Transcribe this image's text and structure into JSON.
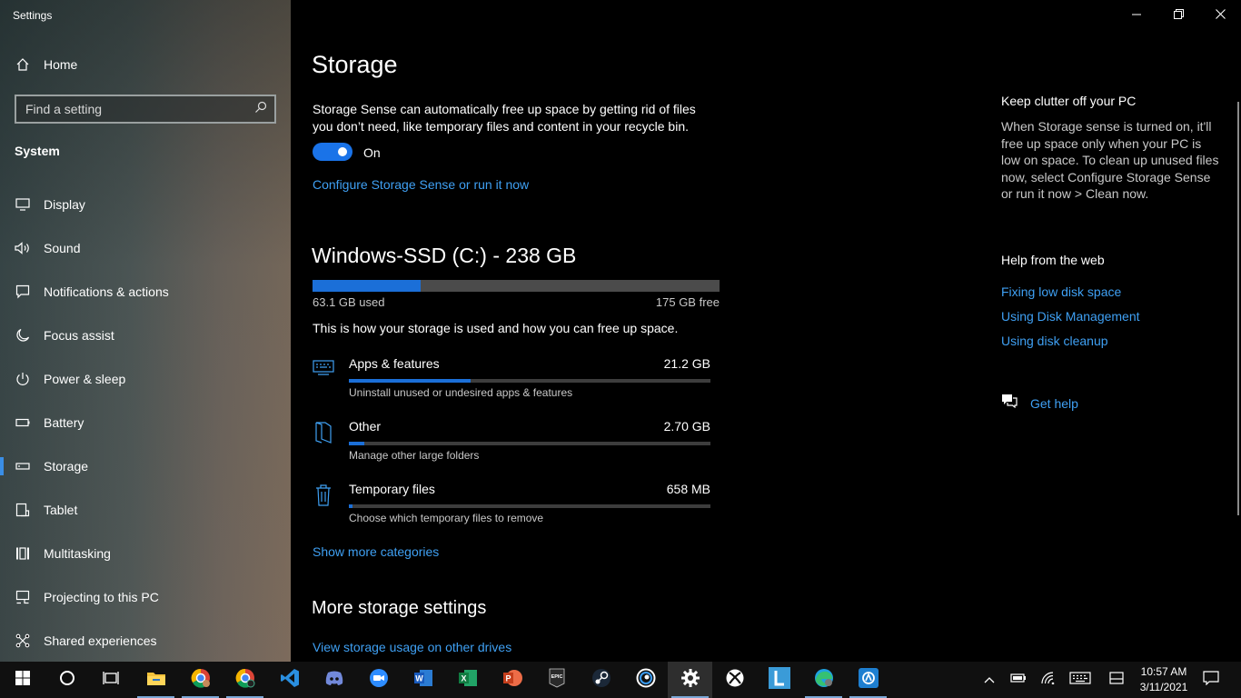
{
  "window": {
    "title": "Settings",
    "controls": {
      "minimize": "minimize",
      "restore": "restore",
      "close": "close"
    }
  },
  "sidebar": {
    "home_label": "Home",
    "search_placeholder": "Find a setting",
    "section_label": "System",
    "items": [
      {
        "label": "Display",
        "icon": "monitor-icon"
      },
      {
        "label": "Sound",
        "icon": "speaker-icon"
      },
      {
        "label": "Notifications & actions",
        "icon": "message-icon"
      },
      {
        "label": "Focus assist",
        "icon": "moon-icon"
      },
      {
        "label": "Power & sleep",
        "icon": "power-icon"
      },
      {
        "label": "Battery",
        "icon": "battery-icon"
      },
      {
        "label": "Storage",
        "icon": "drive-icon",
        "active": true
      },
      {
        "label": "Tablet",
        "icon": "tablet-icon"
      },
      {
        "label": "Multitasking",
        "icon": "multitasking-icon"
      },
      {
        "label": "Projecting to this PC",
        "icon": "projector-icon"
      },
      {
        "label": "Shared experiences",
        "icon": "share-icon"
      }
    ]
  },
  "main": {
    "title": "Storage",
    "storage_sense": {
      "description": "Storage Sense can automatically free up space by getting rid of files you don’t need, like temporary files and content in your recycle bin.",
      "toggle_state": "On",
      "configure_link": "Configure Storage Sense or run it now"
    },
    "drive": {
      "title": "Windows-SSD (C:) - 238 GB",
      "used_label": "63.1 GB used",
      "free_label": "175 GB free",
      "used_fraction": 0.265,
      "usage_description": "This is how your storage is used and how you can free up space."
    },
    "categories": [
      {
        "name": "Apps & features",
        "size": "21.2 GB",
        "description": "Uninstall unused or undesired apps & features",
        "fraction": 0.336,
        "icon": "keyboard-icon"
      },
      {
        "name": "Other",
        "size": "2.70 GB",
        "description": "Manage other large folders",
        "fraction": 0.043,
        "icon": "folder-icon"
      },
      {
        "name": "Temporary files",
        "size": "658 MB",
        "description": "Choose which temporary files to remove",
        "fraction": 0.01,
        "icon": "trash-icon"
      }
    ],
    "show_more_link": "Show more categories",
    "more_settings_title": "More storage settings",
    "other_drives_link": "View storage usage on other drives"
  },
  "side_panel": {
    "clutter_heading": "Keep clutter off your PC",
    "clutter_description": "When Storage sense is turned on, it'll free up space only when your PC is low on space. To clean up unused files now, select Configure Storage Sense or run it now > Clean now.",
    "help_heading": "Help from the web",
    "help_links": [
      "Fixing low disk space",
      "Using Disk Management",
      "Using disk cleanup"
    ],
    "get_help_label": "Get help"
  },
  "taskbar": {
    "apps": [
      "start",
      "cortana",
      "task-view",
      "file-explorer",
      "chrome",
      "chrome",
      "vscode",
      "discord",
      "zoom",
      "word",
      "excel",
      "powerpoint",
      "epic-games",
      "steam",
      "uplay",
      "settings",
      "xbox",
      "l-app",
      "edge",
      "app"
    ],
    "time": "10:57 AM",
    "date": "3/11/2021"
  },
  "colors": {
    "accent": "#1b6fd8",
    "link": "#3fa0f3",
    "background": "#000000"
  }
}
